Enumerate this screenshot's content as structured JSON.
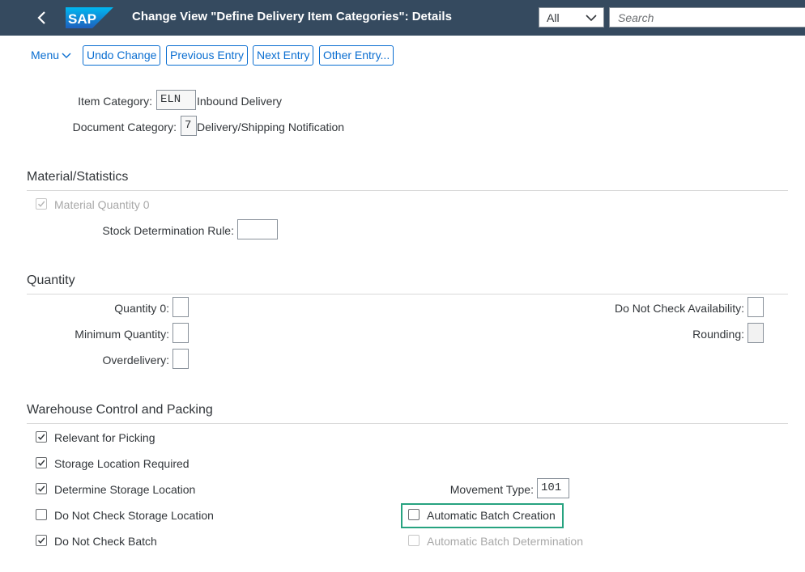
{
  "shell": {
    "title": "Change View \"Define Delivery Item Categories\": Details",
    "scope_value": "All",
    "search_placeholder": "Search",
    "bar_color": "#354a5f"
  },
  "toolbar": {
    "menu_label": "Menu",
    "undo_label": "Undo Change",
    "previous_label": "Previous Entry",
    "next_label": "Next Entry",
    "other_label": "Other Entry..."
  },
  "header": {
    "item_category_label": "Item Category:",
    "item_category_value": "ELN",
    "item_category_desc": "Inbound Delivery",
    "document_category_label": "Document Category:",
    "document_category_value": "7",
    "document_category_desc": "Delivery/Shipping Notification"
  },
  "material": {
    "title": "Material/Statistics",
    "material_quantity_0_label": "Material Quantity 0",
    "material_quantity_0_checked": true,
    "stock_rule_label": "Stock Determination Rule:",
    "stock_rule_value": ""
  },
  "quantity": {
    "title": "Quantity",
    "quantity_0_label": "Quantity 0:",
    "minimum_quantity_label": "Minimum Quantity:",
    "overdelivery_label": "Overdelivery:",
    "do_not_check_availability_label": "Do Not Check Availability:",
    "rounding_label": "Rounding:"
  },
  "warehouse": {
    "title": "Warehouse Control and Packing",
    "relevant_for_picking_label": "Relevant for Picking",
    "relevant_for_picking_checked": true,
    "storage_location_required_label": "Storage Location Required",
    "storage_location_required_checked": true,
    "determine_storage_location_label": "Determine Storage Location",
    "determine_storage_location_checked": true,
    "do_not_check_storage_location_label": "Do Not Check Storage Location",
    "do_not_check_storage_location_checked": false,
    "do_not_check_batch_label": "Do Not Check Batch",
    "do_not_check_batch_checked": true,
    "movement_type_label": "Movement Type:",
    "movement_type_value": "101",
    "automatic_batch_creation_label": "Automatic Batch Creation",
    "automatic_batch_creation_checked": false,
    "automatic_batch_determination_label": "Automatic Batch Determination",
    "automatic_batch_determination_checked": false
  },
  "highlight_color": "#27a380"
}
